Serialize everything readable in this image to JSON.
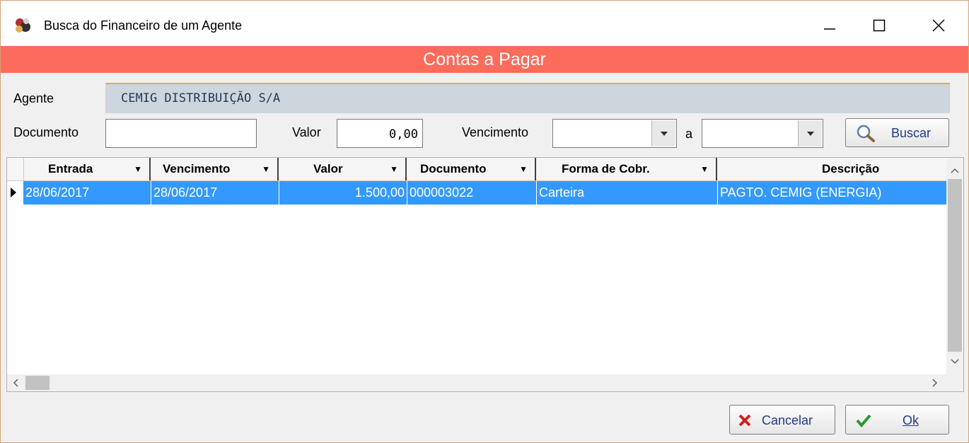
{
  "window": {
    "title": "Busca do Financeiro de um Agente"
  },
  "header": {
    "title": "Contas a Pagar",
    "color": "#fc6b5b"
  },
  "form": {
    "agente_label": "Agente",
    "agente_value": "CEMIG DISTRIBUIÇÃO S/A",
    "documento_label": "Documento",
    "documento_value": "",
    "valor_label": "Valor",
    "valor_value": "0,00",
    "vencimento_label": "Vencimento",
    "vencimento_from": "",
    "a_label": "a",
    "vencimento_to": "",
    "buscar_label": "Buscar"
  },
  "grid": {
    "columns": [
      "Entrada",
      "Vencimento",
      "Valor",
      "Documento",
      "Forma de Cobr.",
      "Descrição"
    ],
    "rows": [
      {
        "entrada": "28/06/2017",
        "vencimento": "28/06/2017",
        "valor": "1.500,00",
        "documento": "000003022",
        "forma": "Carteira",
        "descricao": "PAGTO. CEMIG (ENERGIA)"
      }
    ],
    "selection_color": "#3399ff"
  },
  "buttons": {
    "cancelar": "Cancelar",
    "ok": "Ok"
  }
}
